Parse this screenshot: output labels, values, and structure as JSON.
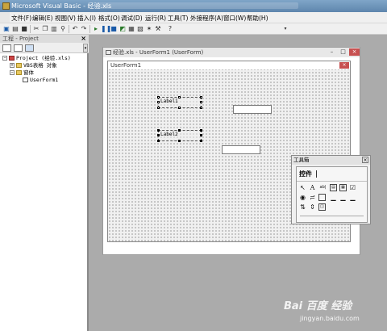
{
  "window": {
    "title": "Microsoft Visual Basic - 经验.xls"
  },
  "menu": [
    "文件(F)",
    "编辑(E)",
    "视图(V)",
    "插入(I)",
    "格式(O)",
    "调试(D)",
    "运行(R)",
    "工具(T)",
    "外接程序(A)",
    "窗口(W)",
    "帮助(H)"
  ],
  "project_pane": {
    "title": "工程 - Project",
    "close": "×",
    "tree": {
      "project": "Project (经验.xls)",
      "excel_objects": "VBS表格 对象",
      "forms_folder": "窗体",
      "form": "UserForm1"
    }
  },
  "child_window": {
    "title": "经验.xls - UserForm1 (UserForm)",
    "close": "×"
  },
  "userform": {
    "caption": "UserForm1",
    "close": "×",
    "label1": "Label1",
    "label2": "Label2"
  },
  "toolbox": {
    "title": "工具箱",
    "close": "×",
    "tab": "控件",
    "tool_a": "A",
    "tool_ab": "ab|"
  },
  "watermark": {
    "brand": "Bai 百度 经验",
    "url": "jingyan.baidu.com"
  },
  "colors": {
    "titlebar": "#6f96bc",
    "canvas": "#ababab",
    "close_red": "#c75050"
  }
}
